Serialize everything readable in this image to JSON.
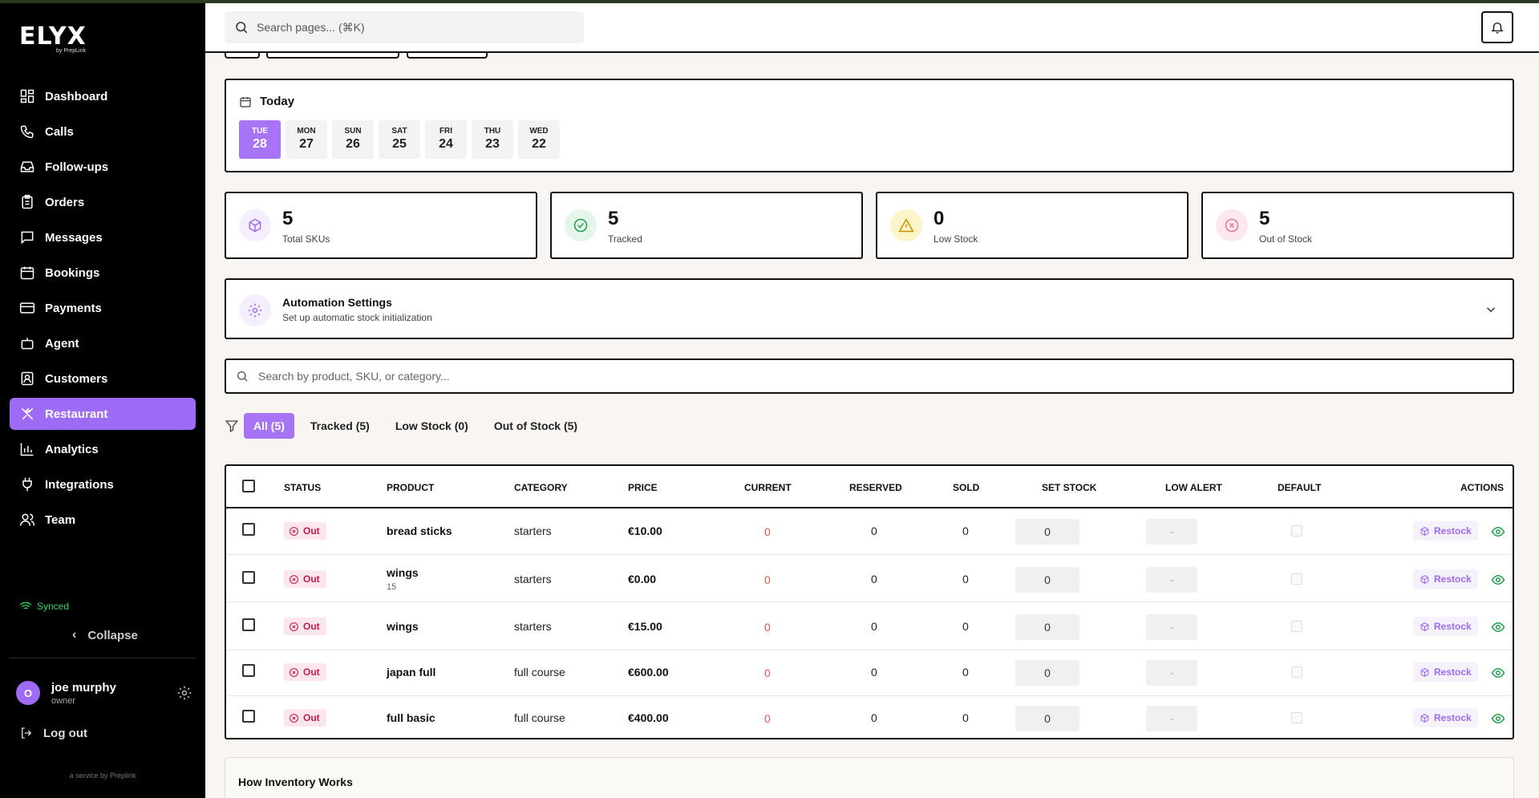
{
  "brand": {
    "name": "ELYX",
    "sub": "by PrepLink"
  },
  "sidebar": {
    "items": [
      {
        "label": "Dashboard",
        "icon": "dashboard-icon"
      },
      {
        "label": "Calls",
        "icon": "phone-icon"
      },
      {
        "label": "Follow-ups",
        "icon": "inbox-icon"
      },
      {
        "label": "Orders",
        "icon": "clipboard-icon"
      },
      {
        "label": "Messages",
        "icon": "message-icon"
      },
      {
        "label": "Bookings",
        "icon": "calendar-icon"
      },
      {
        "label": "Payments",
        "icon": "card-icon"
      },
      {
        "label": "Agent",
        "icon": "bot-icon"
      },
      {
        "label": "Customers",
        "icon": "contact-icon"
      },
      {
        "label": "Restaurant",
        "icon": "utensils-icon",
        "active": true
      },
      {
        "label": "Analytics",
        "icon": "chart-icon"
      },
      {
        "label": "Integrations",
        "icon": "plug-icon"
      },
      {
        "label": "Team",
        "icon": "users-icon"
      }
    ],
    "synced": "Synced",
    "collapse": "Collapse",
    "user": {
      "initial": "O",
      "name": "joe murphy",
      "role": "owner"
    },
    "logout": "Log out",
    "service": "a service by Preplink"
  },
  "topbar": {
    "search_placeholder": "Search pages... (⌘K)"
  },
  "dates": {
    "title": "Today",
    "days": [
      {
        "name": "TUE",
        "num": "28",
        "active": true
      },
      {
        "name": "MON",
        "num": "27"
      },
      {
        "name": "SUN",
        "num": "26"
      },
      {
        "name": "SAT",
        "num": "25"
      },
      {
        "name": "FRI",
        "num": "24"
      },
      {
        "name": "THU",
        "num": "23"
      },
      {
        "name": "WED",
        "num": "22"
      }
    ]
  },
  "stats": [
    {
      "value": "5",
      "label": "Total SKUs",
      "color": "#9d6bf5",
      "bg": "#f4eefd"
    },
    {
      "value": "5",
      "label": "Tracked",
      "color": "#1e9e4a",
      "bg": "#e3f6e9"
    },
    {
      "value": "0",
      "label": "Low Stock",
      "color": "#c99400",
      "bg": "#fdf4c9"
    },
    {
      "value": "5",
      "label": "Out of Stock",
      "color": "#e07a94",
      "bg": "#fde8ee"
    }
  ],
  "automation": {
    "title": "Automation Settings",
    "subtitle": "Set up automatic stock initialization"
  },
  "search": {
    "placeholder": "Search by product, SKU, or category..."
  },
  "filters": [
    {
      "label": "All (5)",
      "active": true
    },
    {
      "label": "Tracked (5)"
    },
    {
      "label": "Low Stock (0)"
    },
    {
      "label": "Out of Stock (5)"
    }
  ],
  "table": {
    "headers": {
      "status": "STATUS",
      "product": "PRODUCT",
      "category": "CATEGORY",
      "price": "PRICE",
      "current": "CURRENT",
      "reserved": "RESERVED",
      "sold": "SOLD",
      "set_stock": "SET STOCK",
      "low_alert": "LOW ALERT",
      "default": "DEFAULT",
      "actions": "ACTIONS"
    },
    "rows": [
      {
        "status": "Out",
        "product": "bread sticks",
        "sub": "",
        "category": "starters",
        "price": "€10.00",
        "current": "0",
        "reserved": "0",
        "sold": "0",
        "set_stock": "0",
        "low_alert": "-",
        "action": "Restock"
      },
      {
        "status": "Out",
        "product": "wings",
        "sub": "15",
        "category": "starters",
        "price": "€0.00",
        "current": "0",
        "reserved": "0",
        "sold": "0",
        "set_stock": "0",
        "low_alert": "-",
        "action": "Restock"
      },
      {
        "status": "Out",
        "product": "wings",
        "sub": "",
        "category": "starters",
        "price": "€15.00",
        "current": "0",
        "reserved": "0",
        "sold": "0",
        "set_stock": "0",
        "low_alert": "-",
        "action": "Restock"
      },
      {
        "status": "Out",
        "product": "japan full",
        "sub": "",
        "category": "full course",
        "price": "€600.00",
        "current": "0",
        "reserved": "0",
        "sold": "0",
        "set_stock": "0",
        "low_alert": "-",
        "action": "Restock"
      },
      {
        "status": "Out",
        "product": "full basic",
        "sub": "",
        "category": "full course",
        "price": "€400.00",
        "current": "0",
        "reserved": "0",
        "sold": "0",
        "set_stock": "0",
        "low_alert": "-",
        "action": "Restock"
      }
    ]
  },
  "how": {
    "title": "How Inventory Works"
  }
}
